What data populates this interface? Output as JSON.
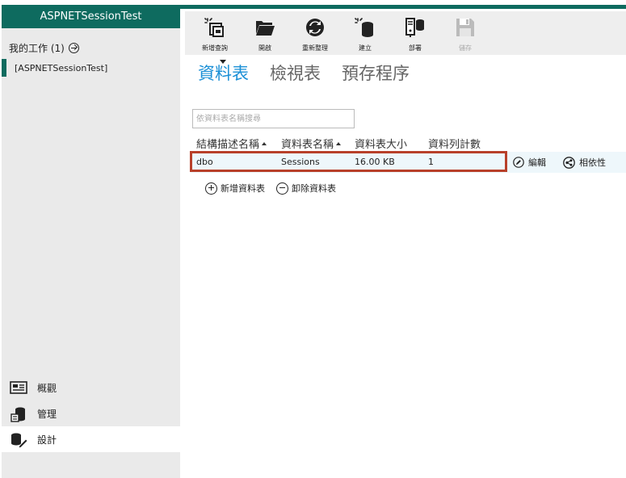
{
  "sidebar": {
    "app_title": "ASPNETSessionTest",
    "my_work_label": "我的工作 (1)",
    "project_item": "[ASPNETSessionTest]",
    "nav": [
      {
        "label": "概觀",
        "icon": "overview-icon"
      },
      {
        "label": "管理",
        "icon": "manage-icon"
      },
      {
        "label": "設計",
        "icon": "design-icon"
      }
    ]
  },
  "toolbar": {
    "tools": [
      {
        "label": "新增查詢",
        "icon": "new-query-icon",
        "enabled": true
      },
      {
        "label": "開啟",
        "icon": "open-folder-icon",
        "enabled": true
      },
      {
        "label": "重新整理",
        "icon": "refresh-icon",
        "enabled": true
      },
      {
        "label": "建立",
        "icon": "create-database-icon",
        "enabled": true
      },
      {
        "label": "部署",
        "icon": "deploy-icon",
        "enabled": true
      },
      {
        "label": "儲存",
        "icon": "save-icon",
        "enabled": false
      }
    ]
  },
  "tabs": [
    {
      "label": "資料表",
      "active": true
    },
    {
      "label": "檢視表",
      "active": false
    },
    {
      "label": "預存程序",
      "active": false
    }
  ],
  "search": {
    "placeholder": "依資料表名稱搜尋"
  },
  "table": {
    "columns": [
      "結構描述名稱",
      "資料表名稱",
      "資料表大小",
      "資料列計數"
    ],
    "rows": [
      {
        "schema": "dbo",
        "name": "Sessions",
        "size": "16.00 KB",
        "count": "1"
      }
    ],
    "row_actions": {
      "edit": "編輯",
      "dependency": "相依性"
    }
  },
  "actions": {
    "add_table": "新增資料表",
    "remove_table": "卸除資料表"
  },
  "colors": {
    "accent": "#0e6b5f",
    "active_tab": "#1a8fd6",
    "highlight_border": "#b8402a"
  }
}
